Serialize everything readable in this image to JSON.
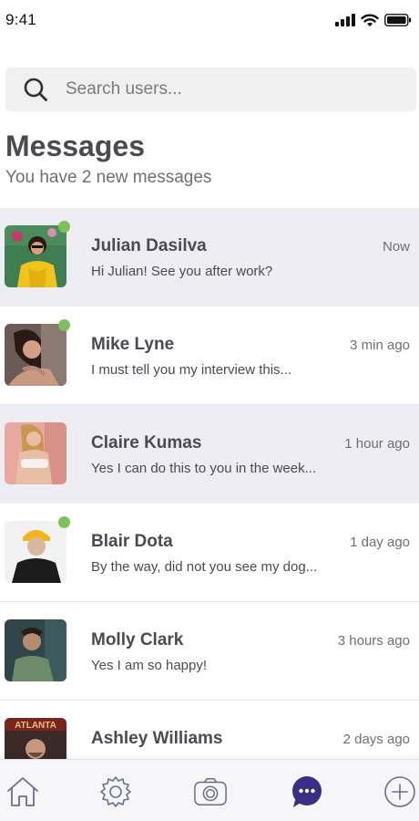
{
  "status_bar": {
    "time": "9:41",
    "icons": [
      "signal-icon",
      "wifi-icon",
      "battery-icon"
    ]
  },
  "search": {
    "placeholder": "Search users...",
    "value": ""
  },
  "header": {
    "title": "Messages",
    "subtitle": "You have 2 new messages"
  },
  "messages": [
    {
      "name": "Julian Dasilva",
      "time": "Now",
      "preview": "Hi Julian! See you after work?",
      "online": true,
      "unread": true
    },
    {
      "name": "Mike Lyne",
      "time": "3 min ago",
      "preview": "I must tell you my interview this...",
      "online": true,
      "unread": false
    },
    {
      "name": "Claire Kumas",
      "time": "1 hour ago",
      "preview": "Yes I can do this to you in the week...",
      "online": false,
      "unread": true
    },
    {
      "name": "Blair Dota",
      "time": "1 day ago",
      "preview": "By the way, did not you see my dog...",
      "online": true,
      "unread": false
    },
    {
      "name": "Molly Clark",
      "time": "3 hours ago",
      "preview": "Yes I am so happy!",
      "online": false,
      "unread": false
    },
    {
      "name": "Ashley Williams",
      "time": "2 days ago",
      "preview": "",
      "online": false,
      "unread": false
    }
  ],
  "avatar_signs": {
    "ashley": "ATLANTA"
  },
  "bottom_nav": {
    "items": [
      "home-icon",
      "settings-icon",
      "camera-icon",
      "chat-icon",
      "add-icon"
    ],
    "active": "chat-icon"
  },
  "colors": {
    "accent": "#3a2f86",
    "online": "#7cc25a",
    "unread_bg": "#ededf3",
    "icon": "#6a6f8e"
  }
}
